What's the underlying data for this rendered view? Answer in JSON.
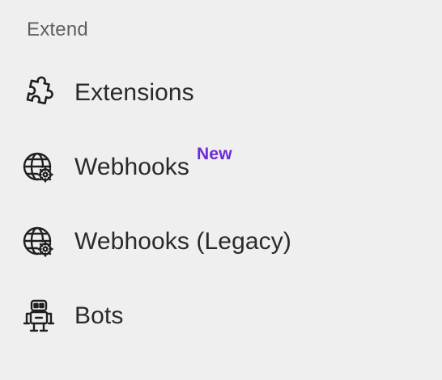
{
  "section": {
    "title": "Extend"
  },
  "items": [
    {
      "id": "extensions",
      "label": "Extensions",
      "icon": "puzzle-icon",
      "badge": ""
    },
    {
      "id": "webhooks",
      "label": "Webhooks",
      "icon": "globe-gear-icon",
      "badge": "New"
    },
    {
      "id": "webhooks-legacy",
      "label": "Webhooks (Legacy)",
      "icon": "globe-gear-icon",
      "badge": ""
    },
    {
      "id": "bots",
      "label": "Bots",
      "icon": "robot-icon",
      "badge": ""
    }
  ],
  "colors": {
    "background": "#efefef",
    "text": "#2a2a2c",
    "section_title": "#5e5e63",
    "badge": "#6c2bd9"
  }
}
